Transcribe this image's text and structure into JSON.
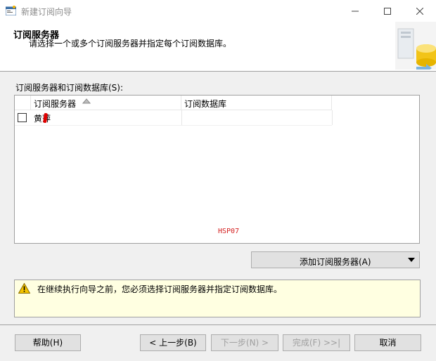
{
  "window": {
    "title": "新建订阅向导",
    "icon": "wizard-app-icon"
  },
  "header": {
    "title": "订阅服务器",
    "subtitle": "请选择一个或多个订阅服务器并指定每个订阅数据库。",
    "art_icon": "database-server-graphic"
  },
  "list": {
    "label": "订阅服务器和订阅数据库(S):",
    "columns": [
      "订阅服务器",
      "订阅数据库"
    ],
    "sort_column": "订阅服务器",
    "rows": [
      {
        "checked": false,
        "subscriber": "黄萍",
        "database": ""
      }
    ]
  },
  "watermark": "HSP07",
  "add_button": {
    "label": "添加订阅服务器(A)"
  },
  "message": {
    "text": "在继续执行向导之前，您必须选择订阅服务器并指定订阅数据库。",
    "icon": "warning-icon"
  },
  "buttons": {
    "help": "帮助(H)",
    "back": "< 上一步(B)",
    "next": "下一步(N) >",
    "finish": "完成(F) >>|",
    "cancel": "取消"
  },
  "colors": {
    "message_bg": "#ffffe1",
    "watermark": "#d42020",
    "mark": "#e00000"
  }
}
